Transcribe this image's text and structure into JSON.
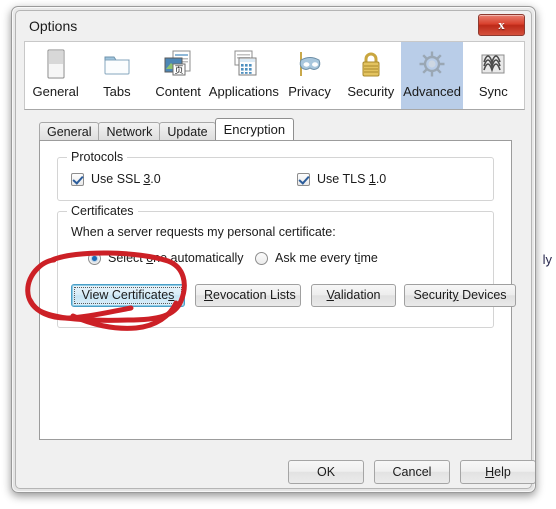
{
  "window": {
    "title": "Options",
    "close_label": "x",
    "close_icon": "close-icon"
  },
  "toolbar": {
    "items": [
      {
        "label": "General",
        "icon": "general-icon",
        "selected": false
      },
      {
        "label": "Tabs",
        "icon": "tabs-folder-icon",
        "selected": false
      },
      {
        "label": "Content",
        "icon": "content-page-icon",
        "selected": false
      },
      {
        "label": "Applications",
        "icon": "applications-icon",
        "selected": false
      },
      {
        "label": "Privacy",
        "icon": "privacy-mask-icon",
        "selected": false
      },
      {
        "label": "Security",
        "icon": "security-lock-icon",
        "selected": false
      },
      {
        "label": "Advanced",
        "icon": "advanced-gear-icon",
        "selected": true
      },
      {
        "label": "Sync",
        "icon": "sync-knot-icon",
        "selected": false
      }
    ],
    "selected_index": 6,
    "selection_color": "#b9cde8"
  },
  "tabs": {
    "items": [
      {
        "label": "General",
        "active": false
      },
      {
        "label": "Network",
        "active": false
      },
      {
        "label": "Update",
        "active": false
      },
      {
        "label": "Encryption",
        "active": true
      }
    ],
    "active_index": 3
  },
  "protocols": {
    "group_title": "Protocols",
    "ssl": {
      "label_before": "Use SSL ",
      "accelerator": "3",
      "label_after": ".0",
      "checked": true
    },
    "tls": {
      "label_before": "Use TLS ",
      "accelerator": "1",
      "label_after": ".0",
      "checked": true
    }
  },
  "certificates": {
    "group_title": "Certificates",
    "prompt": "When a server requests my personal certificate:",
    "options": [
      {
        "label_before": "Select ",
        "accelerator": "o",
        "label_after": "ne automatically",
        "selected": true
      },
      {
        "label_before": "Ask me every t",
        "accelerator": "i",
        "label_after": "me",
        "selected": false
      }
    ],
    "buttons": [
      {
        "label_before": "View Certificate",
        "accelerator": "s",
        "label_after": "",
        "focused": true
      },
      {
        "label_before": "",
        "accelerator": "R",
        "label_after": "evocation Lists",
        "focused": false
      },
      {
        "label_before": "",
        "accelerator": "V",
        "label_after": "alidation",
        "focused": false
      },
      {
        "label_before": "Securit",
        "accelerator": "y",
        "label_after": " Devices",
        "focused": false
      }
    ]
  },
  "footer": {
    "ok_label": "OK",
    "cancel_label": "Cancel",
    "help": {
      "label_before": "",
      "accelerator": "H",
      "label_after": "elp"
    }
  },
  "annotation": {
    "kind": "hand-drawn-circle",
    "color": "#cc2026",
    "target": "View Certificates"
  },
  "background": {
    "text_fragment": "ly"
  }
}
